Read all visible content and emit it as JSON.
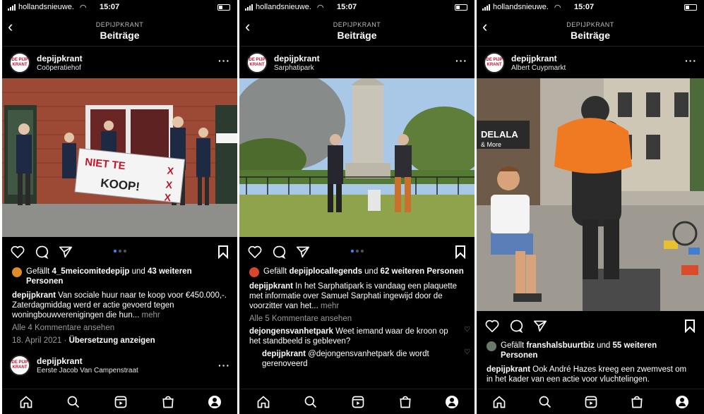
{
  "screens": [
    {
      "status": {
        "carrier": "hollandsnieuwe.",
        "time": "15:07"
      },
      "header": {
        "subtitle": "DEPIJPKRANT",
        "title": "Beiträge"
      },
      "post": {
        "username": "depijpkrant",
        "location": "Coöperatiehof",
        "avatar_text": [
          "DE PIJP",
          "KRANT"
        ],
        "banner_text": [
          "NIET TE",
          "KOOP!"
        ],
        "liked_by_prefix": "Gefällt ",
        "liked_by_user": "4_5meicomitedepijp",
        "liked_by_mid": " und ",
        "liked_by_rest": "43 weiteren Personen",
        "caption_user": "depijpkrant",
        "caption_text": " Van sociale huur naar te koop voor €450.000,-. Zaterdagmiddag werd er actie gevoerd tegen woningbouwverenigingen die hun...",
        "more_label": " mehr",
        "view_comments": "Alle 4 Kommentare ansehen",
        "date": "18. April 2021",
        "date_sep": " · ",
        "translate": "Übersetzung anzeigen"
      },
      "next_post": {
        "username": "depijpkrant",
        "location": "Eerste Jacob Van Campenstraat"
      }
    },
    {
      "status": {
        "carrier": "hollandsnieuwe.",
        "time": "15:07"
      },
      "header": {
        "subtitle": "DEPIJPKRANT",
        "title": "Beiträge"
      },
      "post": {
        "username": "depijpkrant",
        "location": "Sarphatipark",
        "avatar_text": [
          "DE PIJP",
          "KRANT"
        ],
        "liked_by_prefix": "Gefällt ",
        "liked_by_user": "depijplocallegends",
        "liked_by_mid": " und ",
        "liked_by_rest": "62 weiteren Personen",
        "caption_user": "depijpkrant",
        "caption_text": " In het Sarphatipark is vandaag een plaquette met informatie over Samuel Sarphati ingewijd door de voorzitter van het...",
        "more_label": " mehr",
        "view_comments": "Alle 5 Kommentare ansehen",
        "comments": [
          {
            "user": "dejongensvanhetpark",
            "text": " Weet iemand waar de kroon op het standbeeld is gebleven?"
          },
          {
            "user": "depijpkrant",
            "text": " @dejongensvanhetpark die wordt gerenoveerd"
          }
        ]
      }
    },
    {
      "status": {
        "carrier": "hollandsnieuwe.",
        "time": "15:07"
      },
      "header": {
        "subtitle": "DEPIJPKRANT",
        "title": "Beiträge"
      },
      "post": {
        "username": "depijpkrant",
        "location": "Albert Cuypmarkt",
        "avatar_text": [
          "DE PIJP",
          "KRANT"
        ],
        "shop_sign": "DELALA",
        "shop_sub": "& More",
        "liked_by_prefix": "Gefällt ",
        "liked_by_user": "franshalsbuurtbiz",
        "liked_by_mid": " und ",
        "liked_by_rest": "55 weiteren Personen",
        "caption_user": "depijpkrant",
        "caption_text": " Ook André Hazes kreeg een zwemvest om in het kader van een actie voor vluchtelingen."
      }
    }
  ],
  "colors": {
    "background": "#000000",
    "accent_dot": "#2f8cff",
    "muted": "#9a9a9a"
  },
  "icons": [
    "back-chevron-icon",
    "more-icon",
    "heart-icon",
    "comment-icon",
    "share-icon",
    "bookmark-icon",
    "home-icon",
    "search-icon",
    "reels-icon",
    "shop-icon",
    "profile-icon"
  ]
}
